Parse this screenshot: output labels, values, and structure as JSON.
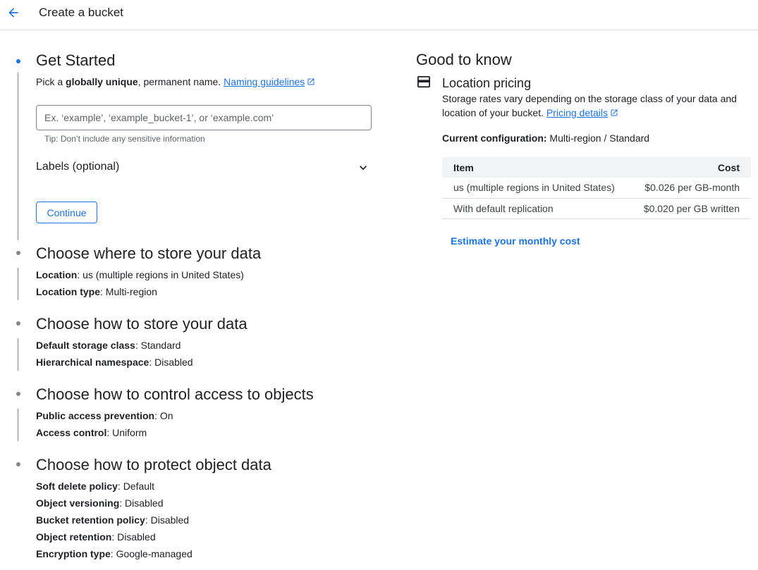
{
  "header": {
    "title": "Create a bucket",
    "back_icon": "arrow-back-icon"
  },
  "steps": {
    "get_started": {
      "title": "Get Started",
      "desc_prefix": "Pick a ",
      "desc_bold": "globally unique",
      "desc_suffix": ", permanent name. ",
      "naming_link": "Naming guidelines",
      "input_placeholder": "Ex. ‘example’, ‘example_bucket-1’, or ‘example.com’",
      "input_value": "",
      "tip": "Tip: Don’t include any sensitive information",
      "labels": "Labels (optional)",
      "continue": "Continue"
    },
    "store_where": {
      "title": "Choose where to store your data",
      "rows": [
        {
          "label": "Location",
          "value": ": us (multiple regions in United States)"
        },
        {
          "label": "Location type",
          "value": ": Multi-region"
        }
      ]
    },
    "store_how": {
      "title": "Choose how to store your data",
      "rows": [
        {
          "label": "Default storage class",
          "value": ": Standard"
        },
        {
          "label": "Hierarchical namespace",
          "value": ": Disabled"
        }
      ]
    },
    "access": {
      "title": "Choose how to control access to objects",
      "rows": [
        {
          "label": "Public access prevention",
          "value": ": On"
        },
        {
          "label": "Access control",
          "value": ": Uniform"
        }
      ]
    },
    "protect": {
      "title": "Choose how to protect object data",
      "rows": [
        {
          "label": "Soft delete policy",
          "value": ": Default"
        },
        {
          "label": "Object versioning",
          "value": ": Disabled"
        },
        {
          "label": "Bucket retention policy",
          "value": ": Disabled"
        },
        {
          "label": "Object retention",
          "value": ": Disabled"
        },
        {
          "label": "Encryption type",
          "value": ": Google-managed"
        }
      ]
    }
  },
  "good_to_know": {
    "title": "Good to know",
    "pricing_title": "Location pricing",
    "pricing_desc": "Storage rates vary depending on the storage class of your data and location of your bucket. ",
    "pricing_link": "Pricing details",
    "config_label": "Current configuration:",
    "config_value": " Multi-region / Standard",
    "table": {
      "headers": [
        "Item",
        "Cost"
      ],
      "rows": [
        [
          "us (multiple regions in United States)",
          "$0.026 per GB-month"
        ],
        [
          "With default replication",
          "$0.020 per GB written"
        ]
      ]
    },
    "estimate": "Estimate your monthly cost"
  },
  "colors": {
    "accent": "#1a73e8",
    "rail": "#80868b",
    "header_bg": "#f1f3f4"
  }
}
